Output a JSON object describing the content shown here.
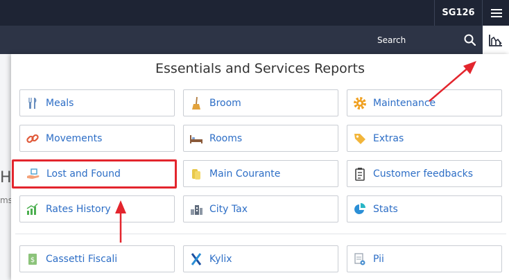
{
  "topbar": {
    "hotel_code": "SG126"
  },
  "searchbar": {
    "search_label": "Search"
  },
  "background": {
    "partial_heading": "H",
    "partial_text": "ms"
  },
  "panel": {
    "title": "Essentials and Services Reports"
  },
  "reports": [
    {
      "label": "Meals",
      "icon": "cutlery-icon"
    },
    {
      "label": "Broom",
      "icon": "broom-icon"
    },
    {
      "label": "Maintenance",
      "icon": "gear-icon"
    },
    {
      "label": "Movements",
      "icon": "link-icon"
    },
    {
      "label": "Rooms",
      "icon": "bed-icon"
    },
    {
      "label": "Extras",
      "icon": "tag-icon"
    },
    {
      "label": "Lost and Found",
      "icon": "hand-box-icon",
      "highlighted": true
    },
    {
      "label": "Main Courante",
      "icon": "coins-icon"
    },
    {
      "label": "Customer feedbacks",
      "icon": "clipboard-icon"
    },
    {
      "label": "Rates History",
      "icon": "bar-chart-icon"
    },
    {
      "label": "City Tax",
      "icon": "city-icon"
    },
    {
      "label": "Stats",
      "icon": "pie-chart-icon"
    },
    {
      "label": "Cassetti Fiscali",
      "icon": "cash-icon"
    },
    {
      "label": "Kylix",
      "icon": "kylix-icon"
    },
    {
      "label": "Pii",
      "icon": "document-gear-icon"
    }
  ],
  "colors": {
    "topbar": "#1e2434",
    "searchbar": "#2d3446",
    "link": "#2d6ec6",
    "highlight": "#e3252d"
  }
}
